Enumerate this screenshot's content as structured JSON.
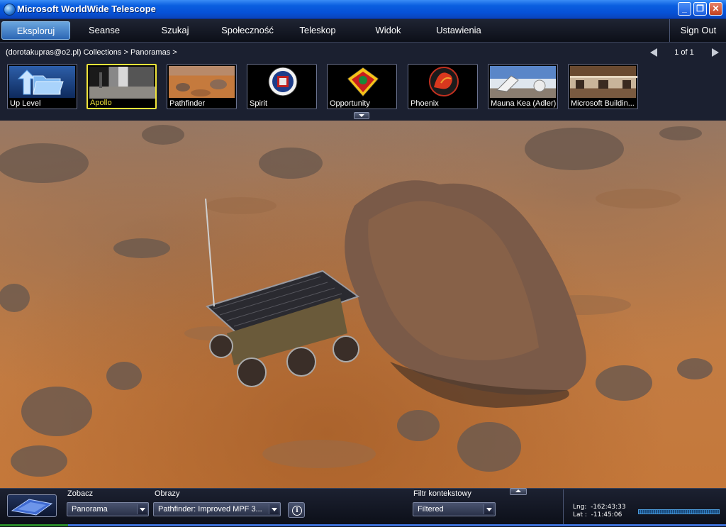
{
  "window": {
    "title": "Microsoft WorldWide Telescope"
  },
  "menu": {
    "tabs": [
      "Eksploruj",
      "Seanse",
      "Szukaj",
      "Społeczność",
      "Teleskop",
      "Widok",
      "Ustawienia"
    ],
    "active_tab": "Eksploruj",
    "sign_out": "Sign Out"
  },
  "breadcrumb": {
    "text": "(dorotakupras@o2.pl) Collections  >  Panoramas  >"
  },
  "pager": {
    "label": "1 of 1"
  },
  "thumbnails": [
    {
      "label": "Up Level",
      "icon": "folder-up-icon"
    },
    {
      "label": "Apollo",
      "selected": true
    },
    {
      "label": "Pathfinder"
    },
    {
      "label": "Spirit"
    },
    {
      "label": "Opportunity"
    },
    {
      "label": "Phoenix"
    },
    {
      "label": "Mauna Kea (Adler)"
    },
    {
      "label": "Microsoft Buildin..."
    }
  ],
  "bottom": {
    "look_label": "Zobacz",
    "look_value": "Panorama",
    "imagery_label": "Obrazy",
    "imagery_value": "Pathfinder: Improved MPF 3...",
    "filter_label": "Filtr kontekstowy",
    "filter_value": "Filtered",
    "lng": "Lng:  -162:43:33",
    "lat": "Lat :  -11:45:06"
  },
  "colors": {
    "selected_border": "#f0e43a",
    "title_bar": "#0651d6",
    "active_tab": "#2c67b5"
  }
}
